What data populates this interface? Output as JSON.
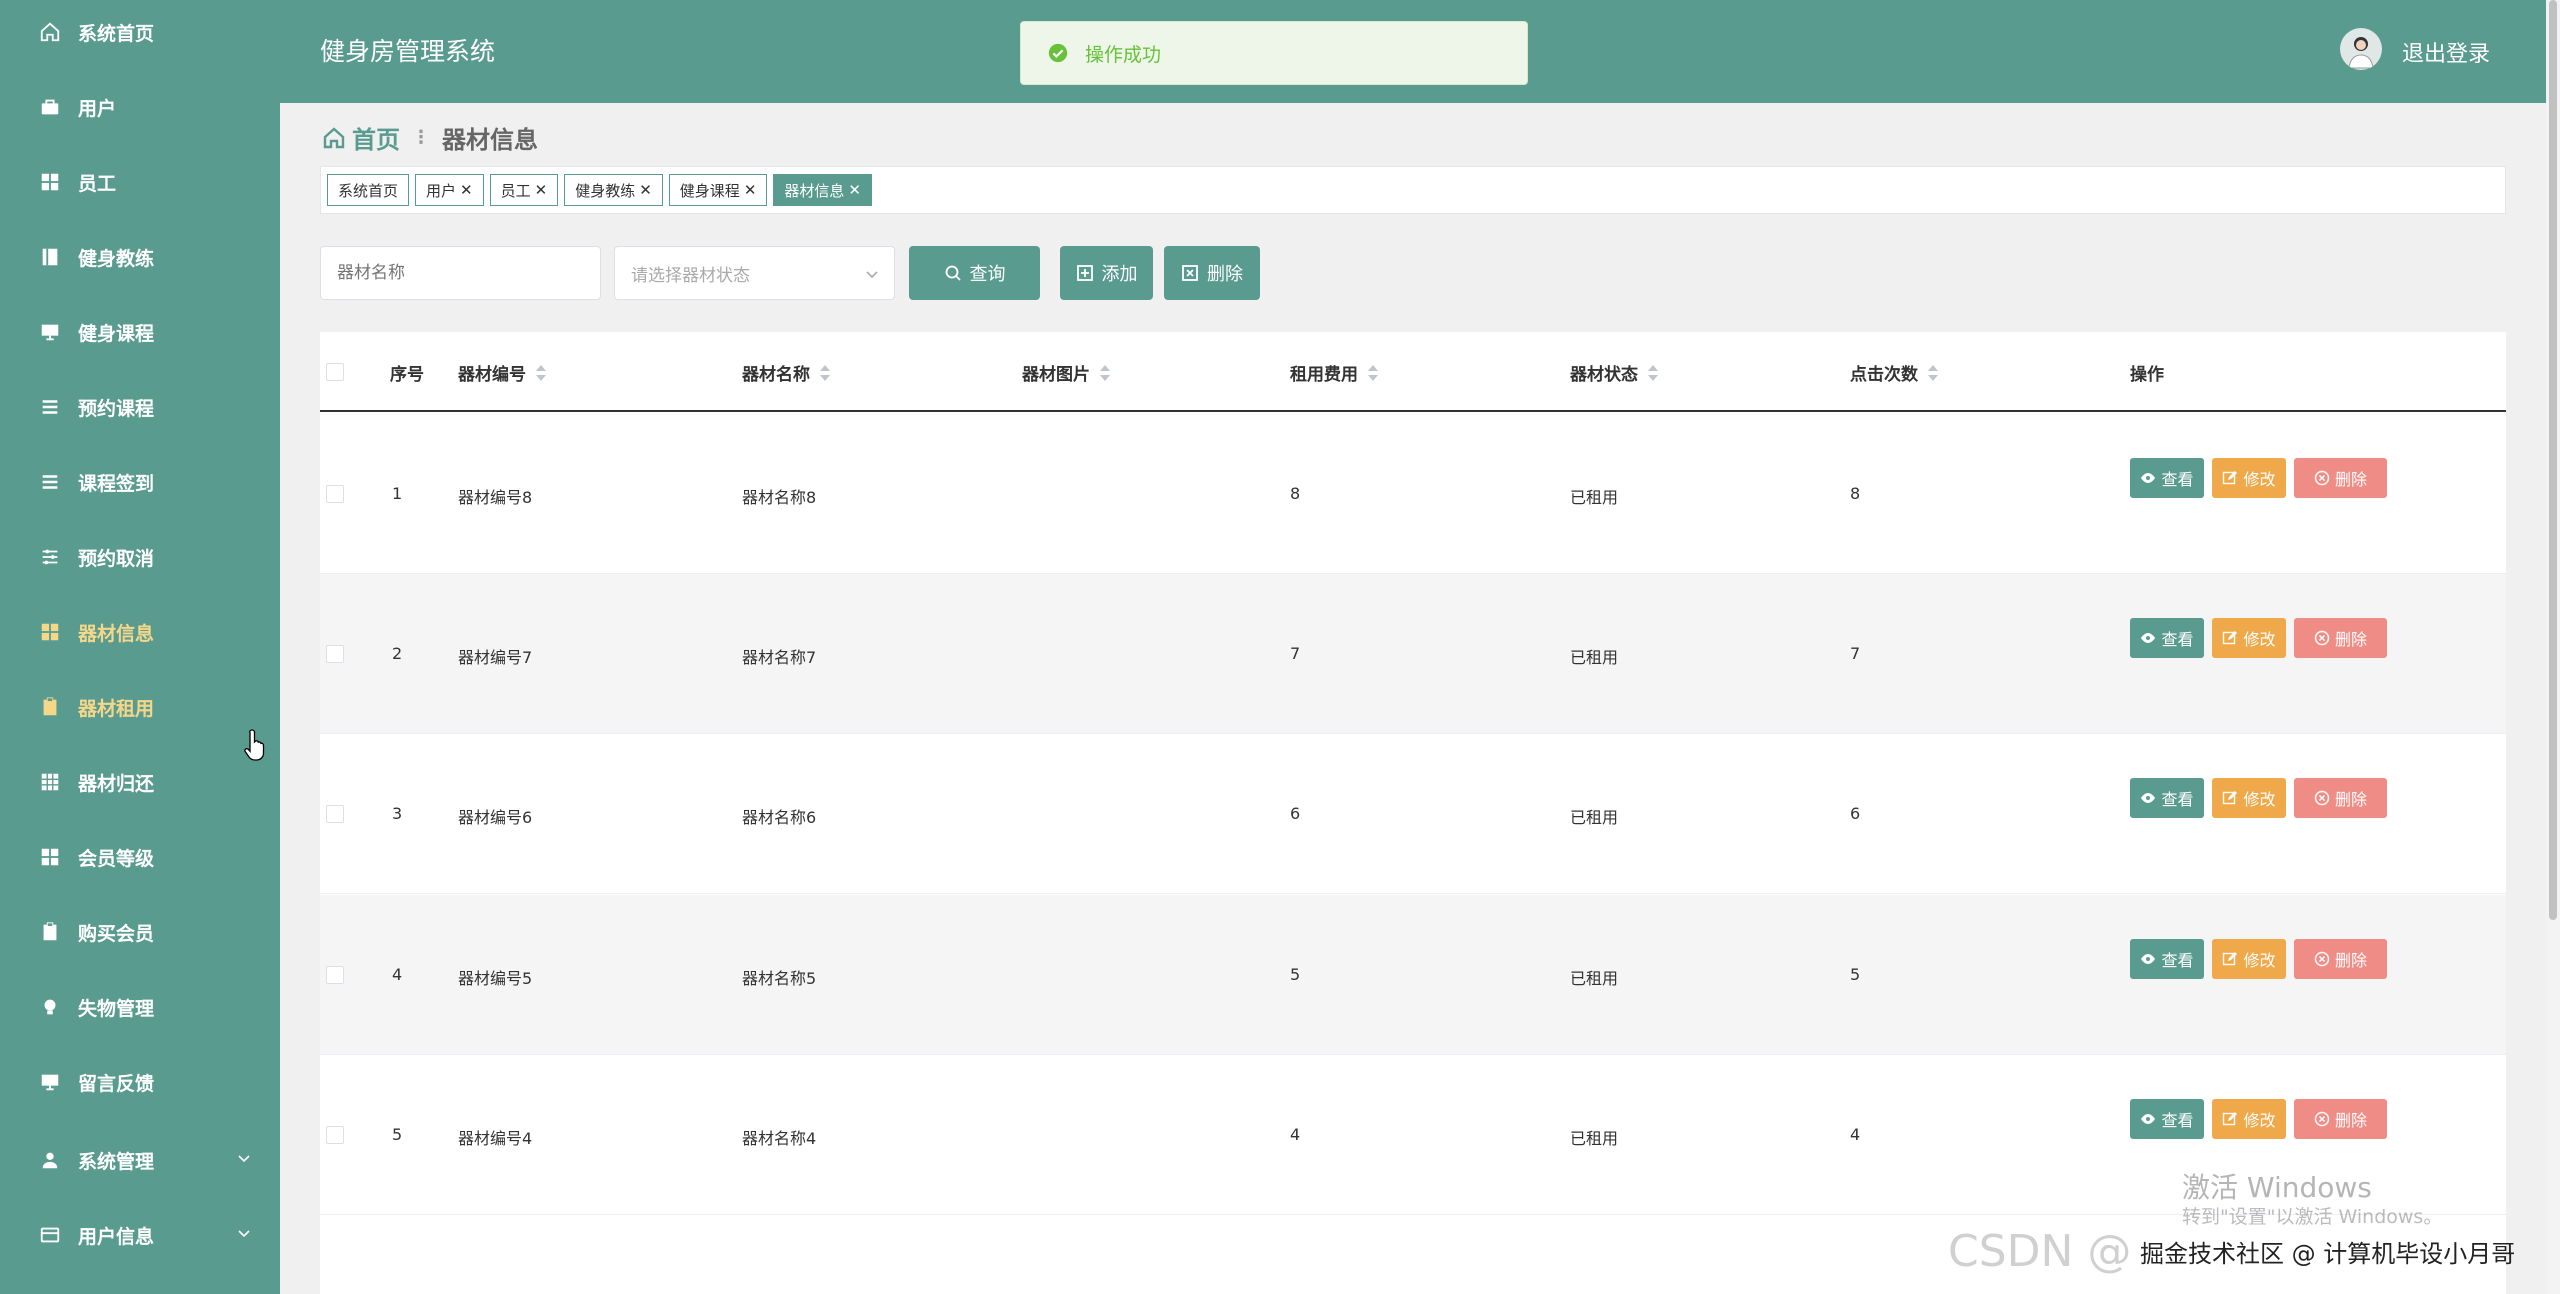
{
  "app": {
    "title": "健身房管理系统",
    "logout_label": "退出登录",
    "toast": "操作成功"
  },
  "sidebar": {
    "items": [
      {
        "label": "系统首页",
        "icon": "home-icon"
      },
      {
        "label": "用户",
        "icon": "briefcase-icon"
      },
      {
        "label": "员工",
        "icon": "grid-icon"
      },
      {
        "label": "健身教练",
        "icon": "book-icon"
      },
      {
        "label": "健身课程",
        "icon": "monitor-icon"
      },
      {
        "label": "预约课程",
        "icon": "list-icon"
      },
      {
        "label": "课程签到",
        "icon": "list-icon"
      },
      {
        "label": "预约取消",
        "icon": "sliders-icon"
      },
      {
        "label": "器材信息",
        "icon": "grid-icon"
      },
      {
        "label": "器材租用",
        "icon": "clipboard-icon"
      },
      {
        "label": "器材归还",
        "icon": "table-icon"
      },
      {
        "label": "会员等级",
        "icon": "grid-icon"
      },
      {
        "label": "购买会员",
        "icon": "clipboard-icon"
      },
      {
        "label": "失物管理",
        "icon": "bulb-icon"
      },
      {
        "label": "留言反馈",
        "icon": "monitor-icon"
      },
      {
        "label": "系统管理",
        "icon": "user-icon"
      },
      {
        "label": "用户信息",
        "icon": "card-icon"
      }
    ]
  },
  "breadcrumb": {
    "home": "首页",
    "current": "器材信息"
  },
  "tags": [
    {
      "label": "系统首页",
      "closable": false
    },
    {
      "label": "用户",
      "closable": true
    },
    {
      "label": "员工",
      "closable": true
    },
    {
      "label": "健身教练",
      "closable": true
    },
    {
      "label": "健身课程",
      "closable": true
    },
    {
      "label": "器材信息",
      "closable": true
    }
  ],
  "filters": {
    "name_placeholder": "器材名称",
    "status_placeholder": "请选择器材状态",
    "query_label": "查询",
    "add_label": "添加",
    "delete_label": "删除"
  },
  "table": {
    "columns": [
      "序号",
      "器材编号",
      "器材名称",
      "器材图片",
      "租用费用",
      "器材状态",
      "点击次数",
      "操作"
    ],
    "rows": [
      {
        "index": "1",
        "code": "器材编号8",
        "name": "器材名称8",
        "fee": "8",
        "status": "已租用",
        "clicks": "8"
      },
      {
        "index": "2",
        "code": "器材编号7",
        "name": "器材名称7",
        "fee": "7",
        "status": "已租用",
        "clicks": "7"
      },
      {
        "index": "3",
        "code": "器材编号6",
        "name": "器材名称6",
        "fee": "6",
        "status": "已租用",
        "clicks": "6"
      },
      {
        "index": "4",
        "code": "器材编号5",
        "name": "器材名称5",
        "fee": "5",
        "status": "已租用",
        "clicks": "5"
      },
      {
        "index": "5",
        "code": "器材编号4",
        "name": "器材名称4",
        "fee": "4",
        "status": "已租用",
        "clicks": "4"
      }
    ],
    "actions": {
      "view": "查看",
      "edit": "修改",
      "delete": "删除"
    }
  },
  "watermark": {
    "activate_title": "激活 Windows",
    "activate_sub": "转到\"设置\"以激活 Windows。",
    "csdn": "CSDN @",
    "credit": "掘金技术社区 @ 计算机毕设小月哥"
  },
  "colors": {
    "primary": "#5a9b90",
    "edit": "#f0a94a",
    "delete": "#f08c86",
    "active_nav": "#f5d78a",
    "success": "#67c23a"
  }
}
